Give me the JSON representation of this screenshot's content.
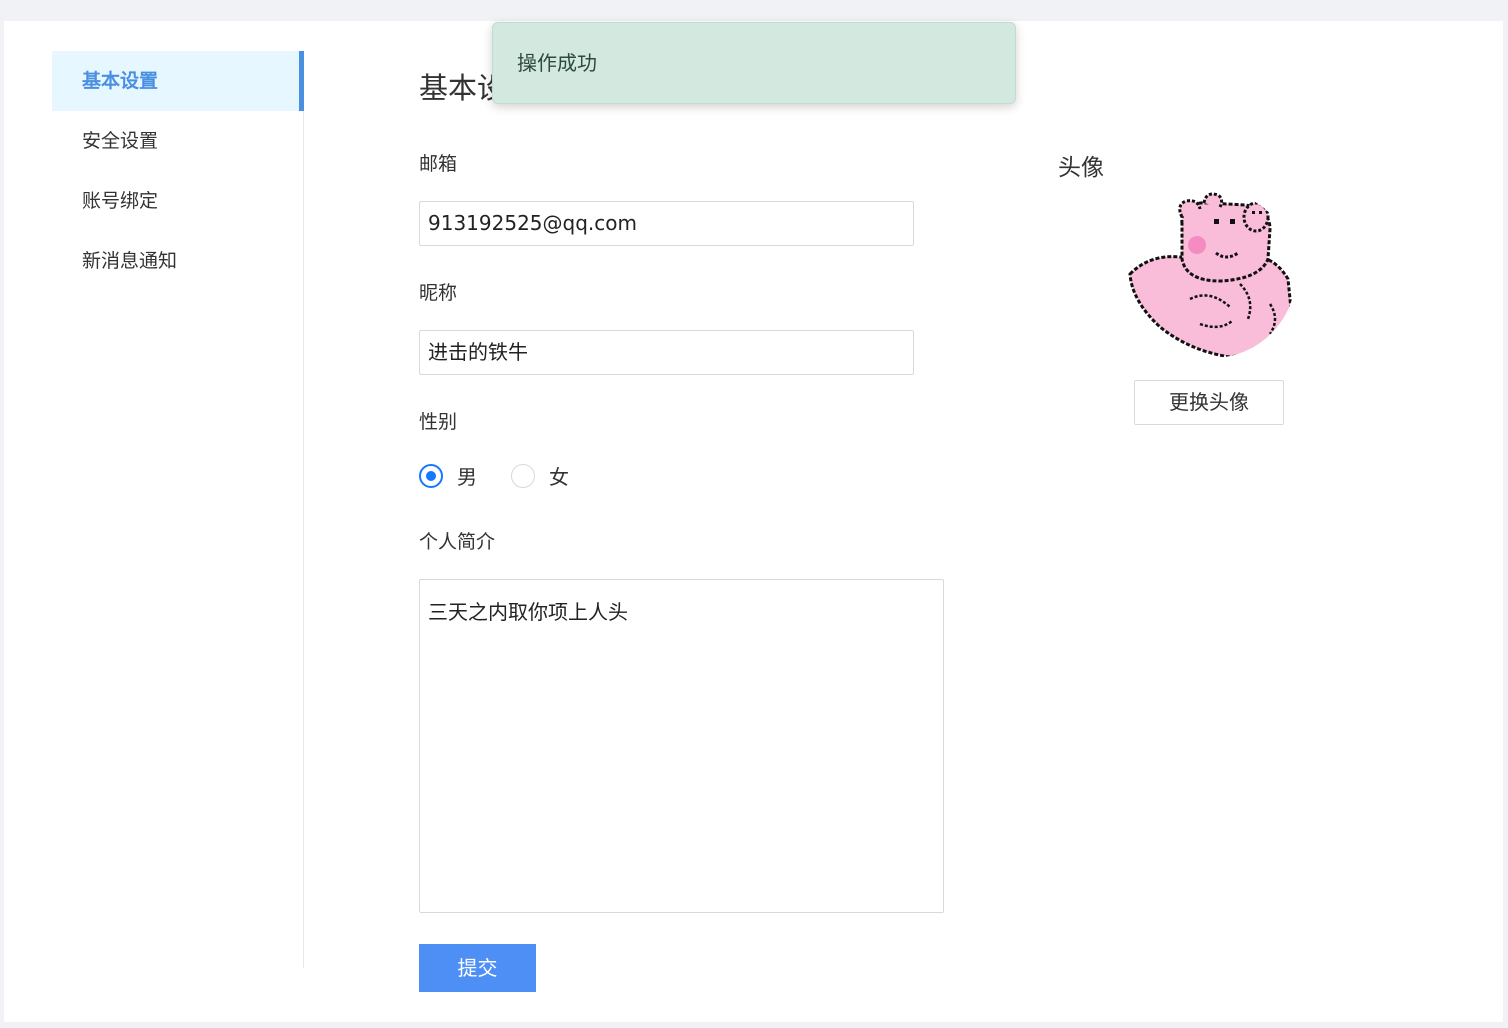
{
  "sidebar": {
    "items": [
      {
        "label": "基本设置",
        "active": true
      },
      {
        "label": "安全设置",
        "active": false
      },
      {
        "label": "账号绑定",
        "active": false
      },
      {
        "label": "新消息通知",
        "active": false
      }
    ]
  },
  "main": {
    "title": "基本设",
    "email": {
      "label": "邮箱",
      "value": "913192525@qq.com"
    },
    "nickname": {
      "label": "昵称",
      "value": "进击的铁牛"
    },
    "gender": {
      "label": "性别",
      "options": [
        "男",
        "女"
      ],
      "selected": "男"
    },
    "bio": {
      "label": "个人简介",
      "value": "三天之内取你项上人头"
    },
    "submit_label": "提交"
  },
  "avatar": {
    "title": "头像",
    "change_label": "更换头像",
    "icon": "pink-pig-avatar"
  },
  "toast": {
    "message": "操作成功"
  },
  "colors": {
    "accent": "#4a90e2",
    "primary_button": "#4e8ff5",
    "radio_checked": "#1677ff",
    "toast_bg": "#d3e8df",
    "active_menu_bg": "#e6f7ff"
  }
}
